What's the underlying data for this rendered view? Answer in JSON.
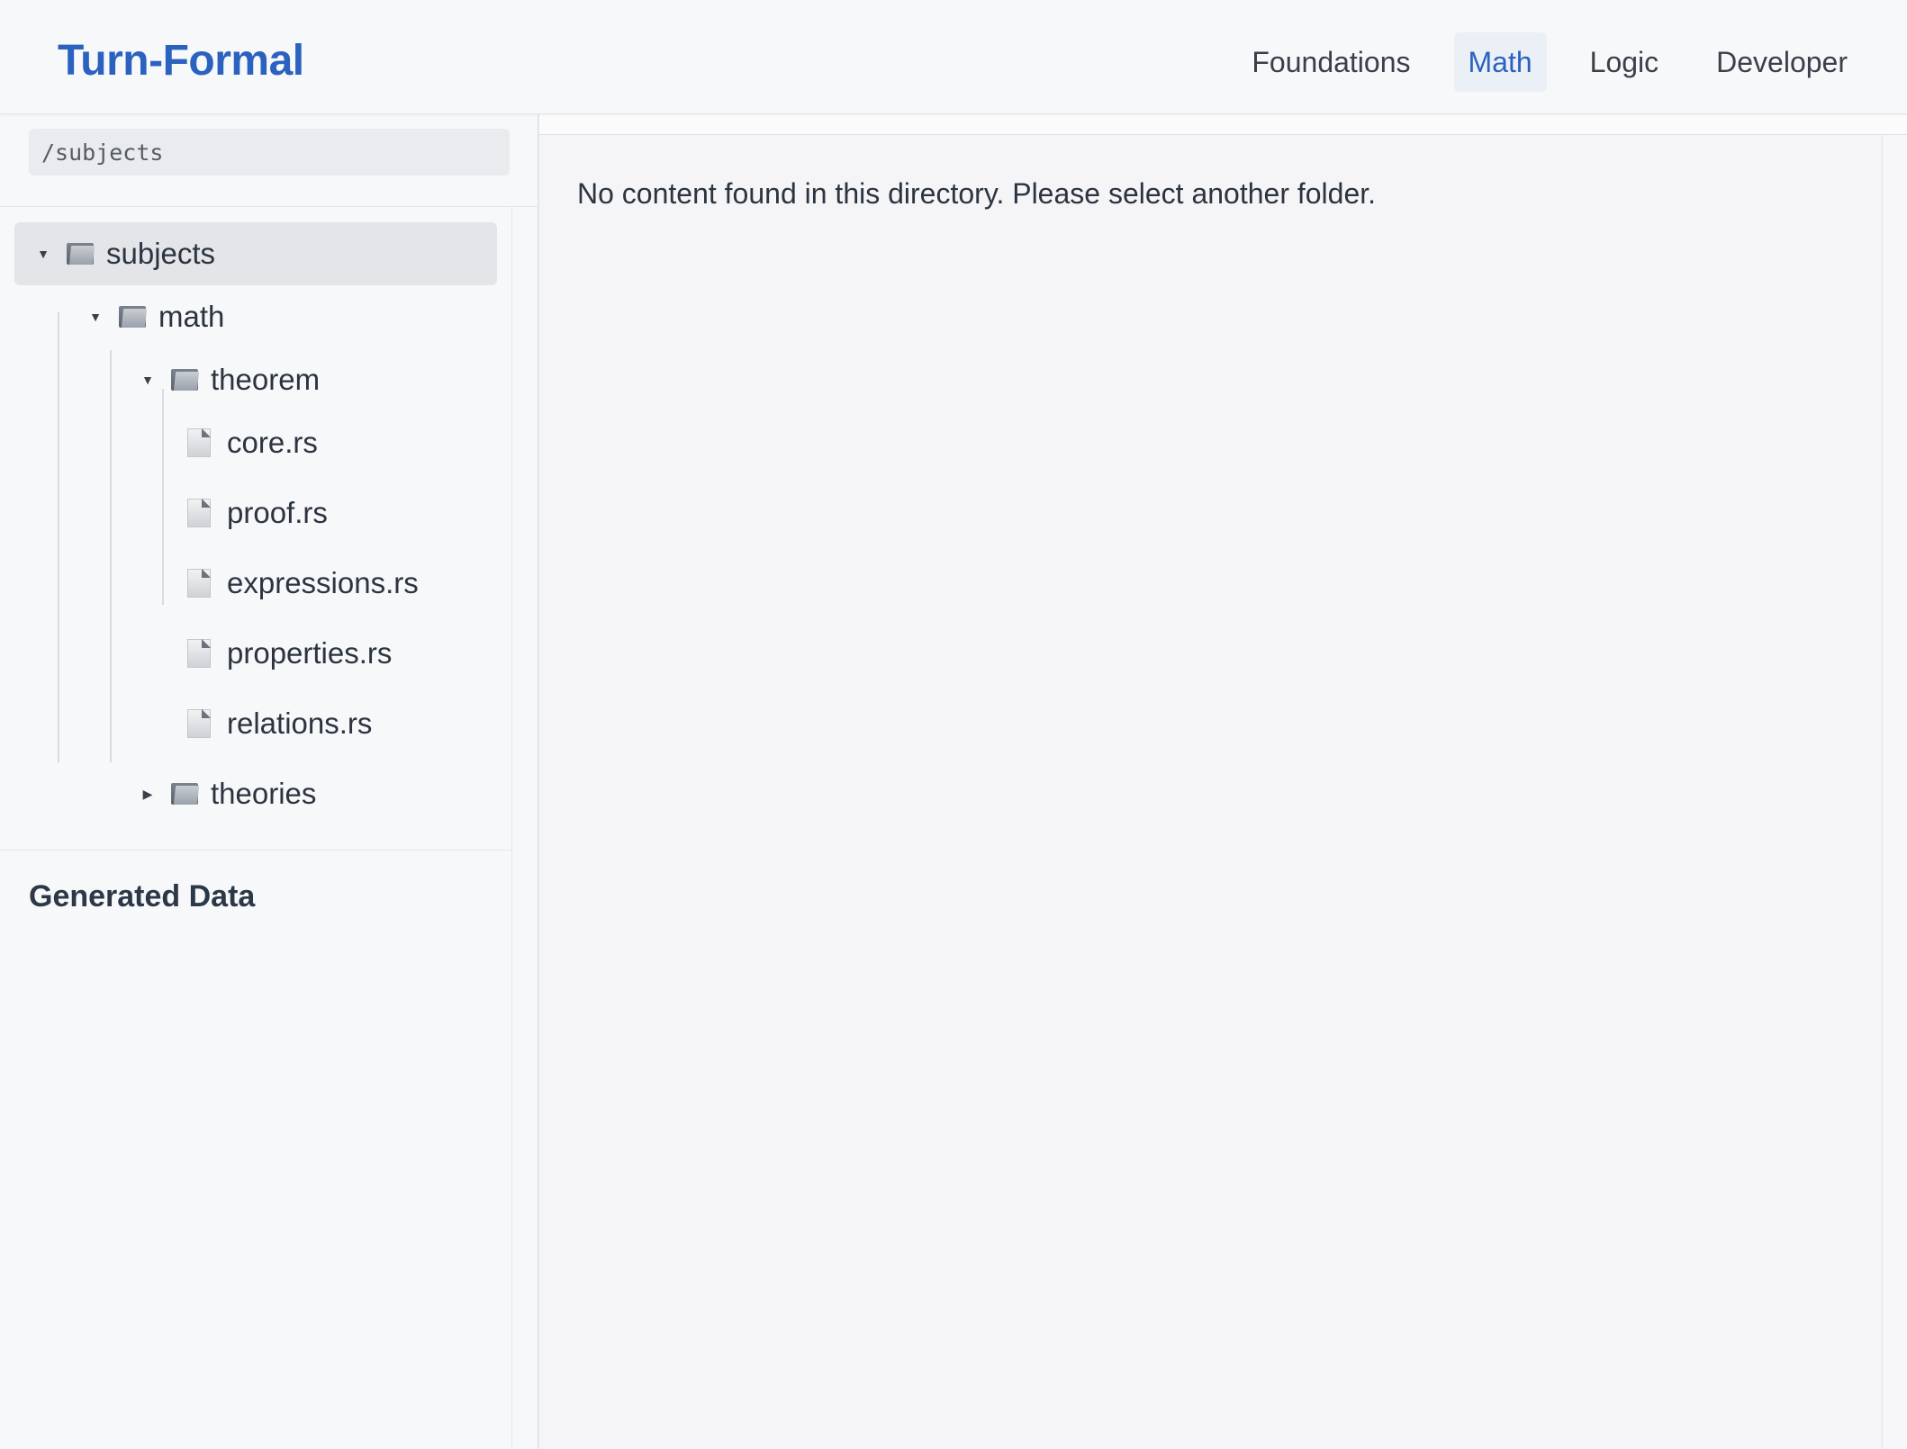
{
  "header": {
    "brand": "Turn-Formal",
    "nav": [
      "Foundations",
      "Math",
      "Logic",
      "Developer"
    ],
    "active_nav": "Math"
  },
  "sidebar": {
    "path": "/subjects",
    "tree": {
      "subjects": "subjects",
      "math": "math",
      "theorem": "theorem",
      "files": [
        "core.rs",
        "proof.rs",
        "expressions.rs",
        "properties.rs",
        "relations.rs"
      ],
      "theories": "theories"
    },
    "generated_title": "Generated Data"
  },
  "main": {
    "message": "No content found in this directory. Please select another folder."
  },
  "colors": {
    "brand": "#2b62c0",
    "active_bg": "#ebeff6",
    "selected_bg": "#e3e5e9"
  },
  "icons": {
    "folder": "folder-icon",
    "file": "file-icon",
    "caret_open": "caret-down-icon",
    "caret_closed": "caret-right-icon"
  }
}
